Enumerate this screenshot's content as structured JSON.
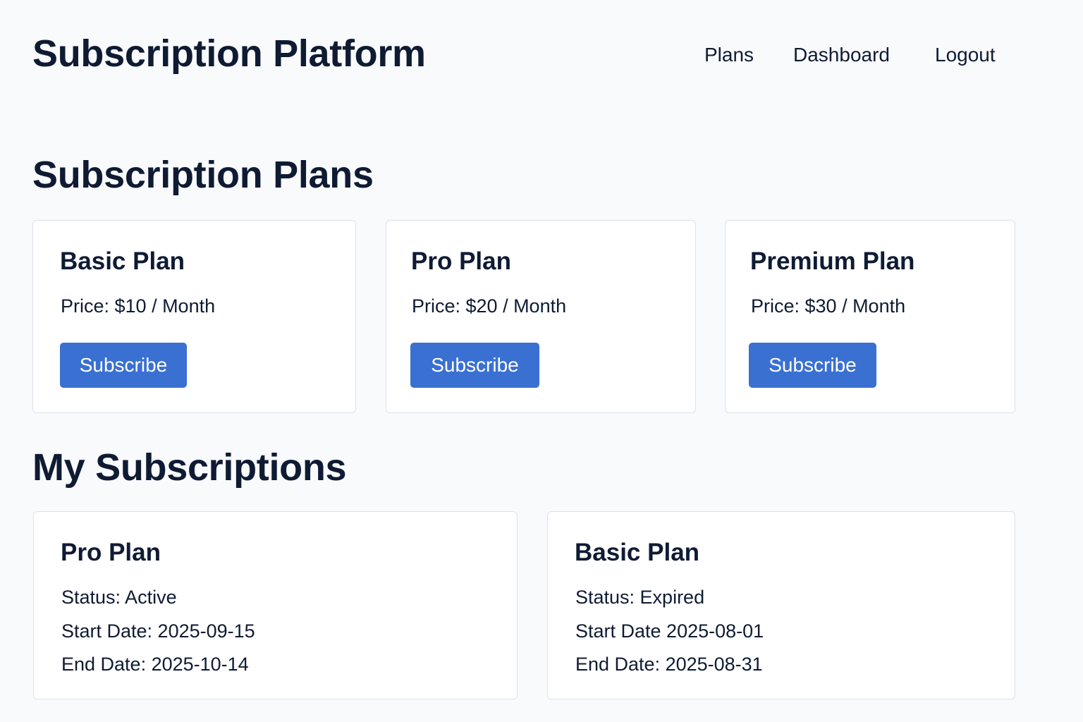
{
  "header": {
    "title": "Subscription Platform",
    "nav": [
      {
        "label": "Plans"
      },
      {
        "label": "Dashboard"
      },
      {
        "label": "Logout"
      }
    ]
  },
  "plans_section": {
    "title": "Subscription Plans",
    "plans": [
      {
        "name": "Basic Plan",
        "price": "Price: $10 / Month",
        "button": "Subscribe"
      },
      {
        "name": "Pro Plan",
        "price": "Price: $20 / Month",
        "button": "Subscribe"
      },
      {
        "name": "Premium Plan",
        "price": "Price: $30 / Month",
        "button": "Subscribe"
      }
    ]
  },
  "subscriptions_section": {
    "title": "My Subscriptions",
    "items": [
      {
        "name": "Pro Plan",
        "status": "Status: Active",
        "start": "Start Date: 2025-09-15",
        "end": "End Date: 2025-10-14"
      },
      {
        "name": "Basic Plan",
        "status": "Status: Expired",
        "start": "Start Date 2025-08-01",
        "end": "End Date: 2025-08-31"
      }
    ]
  },
  "colors": {
    "background": "#f8fafc",
    "text": "#0f1b33",
    "accent": "#3a70d1",
    "card_border": "#dde3ea"
  }
}
